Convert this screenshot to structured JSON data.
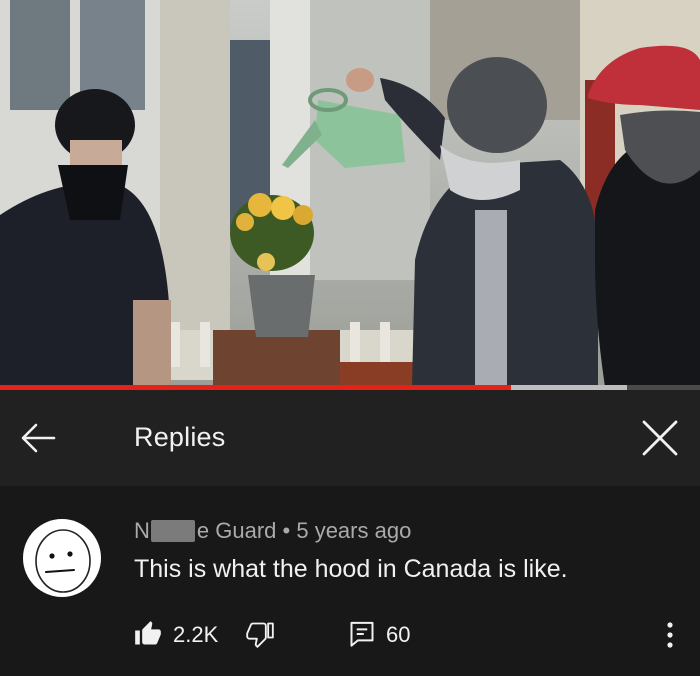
{
  "header": {
    "title": "Replies"
  },
  "comment": {
    "author_prefix": "N",
    "author_suffix": "e Guard",
    "separator": "•",
    "timestamp": "5 years ago",
    "text": "This is what the hood in Canada is like.",
    "like_count": "2.2K",
    "reply_count": "60"
  },
  "video": {
    "progress_played": 0.73,
    "progress_buffered": 0.895
  },
  "colors": {
    "accent": "#e62117",
    "background": "#181818",
    "header": "#212121",
    "secondary_text": "#aaaaaa"
  },
  "icons": [
    "back-arrow-icon",
    "close-icon",
    "avatar-icon",
    "thumbs-up-icon",
    "thumbs-down-icon",
    "reply-icon",
    "more-vert-icon"
  ]
}
